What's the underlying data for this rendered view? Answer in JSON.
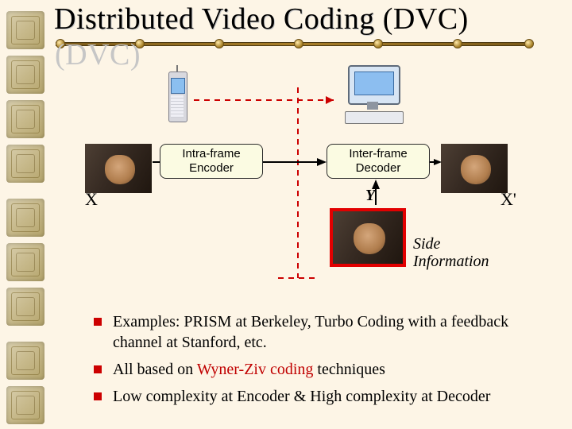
{
  "title": "Distributed Video Coding (DVC)",
  "blocks": {
    "encoder": "Intra-frame\nEncoder",
    "decoder": "Inter-frame\nDecoder"
  },
  "labels": {
    "x": "X",
    "xprime": "X'",
    "y": "Y",
    "side_info_l1": "Side",
    "side_info_l2": "Information"
  },
  "bullets": {
    "b1_pre": "Examples: PRISM at Berkeley, Turbo Coding with a feedback channel at Stanford, etc.",
    "b2_pre": "All based on ",
    "b2_em": "Wyner-Ziv coding",
    "b2_post": " techniques",
    "b3": "Low complexity at Encoder & High complexity at Decoder"
  }
}
